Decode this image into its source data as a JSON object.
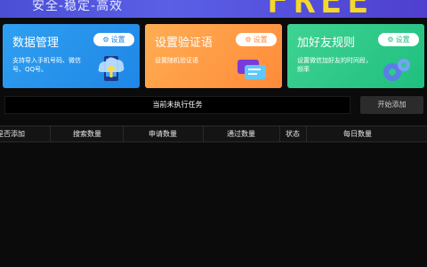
{
  "banner": {
    "tagline": "安全-稳定-高效",
    "big_text": "FREE"
  },
  "cards": [
    {
      "title": "数据管理",
      "button": "设置",
      "desc": "支持导入手机号码、微信号、QQ号。",
      "color": "#2fa0f0",
      "art": "phone-cloud-art"
    },
    {
      "title": "设置验证语",
      "button": "设置",
      "desc": "设置随机验证语",
      "color": "#ff9a45",
      "art": "chat-bubbles-art"
    },
    {
      "title": "加好友规则",
      "button": "设置",
      "desc": "设置微信加好友的时间段，频率",
      "color": "#2ecb8a",
      "art": "gears-art"
    }
  ],
  "status": {
    "text": "当前未执行任务"
  },
  "start_button": {
    "label": "开始添加"
  },
  "table": {
    "columns": [
      "是否添加",
      "搜索数量",
      "申请数量",
      "通过数量",
      "状态",
      "每日数量"
    ],
    "rows": []
  }
}
